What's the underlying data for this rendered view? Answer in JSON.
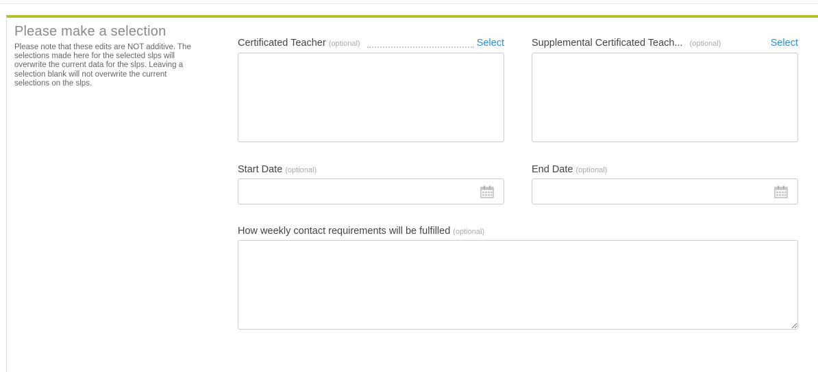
{
  "intro": {
    "title": "Please make a selection",
    "text": "Please note that these edits are NOT additive. The selections made here for the selected slps will overwrite the current data for the slps. Leaving a selection blank will not overwrite the current selections on the slps."
  },
  "fields": {
    "certificated_teacher": {
      "label": "Certificated Teacher",
      "optional": "(optional)",
      "action": "Select",
      "value": ""
    },
    "supplemental_teacher": {
      "label": "Supplemental Certificated Teach...",
      "optional": "(optional)",
      "action": "Select",
      "value": ""
    },
    "start_date": {
      "label": "Start Date",
      "optional": "(optional)",
      "value": "",
      "icon": "calendar-icon"
    },
    "end_date": {
      "label": "End Date",
      "optional": "(optional)",
      "value": "",
      "icon": "calendar-icon"
    },
    "weekly_contact": {
      "label": "How weekly contact requirements will be fulfilled",
      "optional": "(optional)",
      "value": ""
    }
  },
  "colors": {
    "accent_bar": "#b5c234",
    "link": "#2a8fd8"
  }
}
